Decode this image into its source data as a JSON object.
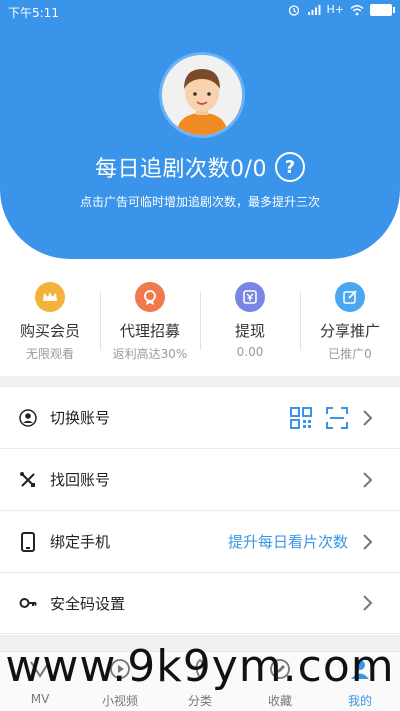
{
  "status_bar": {
    "time": "下午5:11",
    "network": "H+"
  },
  "header": {
    "title": "每日追剧次数0/0",
    "help_label": "?",
    "subtitle": "点击广告可临时增加追剧次数，最多提升三次"
  },
  "stats": [
    {
      "label": "购买会员",
      "value": "无限观看",
      "icon": "crown-icon",
      "color": "#f3b33a"
    },
    {
      "label": "代理招募",
      "value": "返利高达30%",
      "icon": "medal-icon",
      "color": "#f07a4e"
    },
    {
      "label": "提现",
      "value": "0.00",
      "icon": "yen-icon",
      "color": "#7a86e6"
    },
    {
      "label": "分享推广",
      "value": "已推广0",
      "icon": "edit-icon",
      "color": "#4aa6ee"
    }
  ],
  "menu": {
    "switch_account": "切换账号",
    "recover_account": "找回账号",
    "bind_phone": "绑定手机",
    "bind_phone_hint": "提升每日看片次数",
    "security_code": "安全码设置"
  },
  "tabs": [
    {
      "label": "MV"
    },
    {
      "label": "小视频"
    },
    {
      "label": "分类"
    },
    {
      "label": "收藏"
    },
    {
      "label": "我的"
    }
  ],
  "watermark": "www.9k9ym.com",
  "colors": {
    "brand": "#3a95ea"
  }
}
